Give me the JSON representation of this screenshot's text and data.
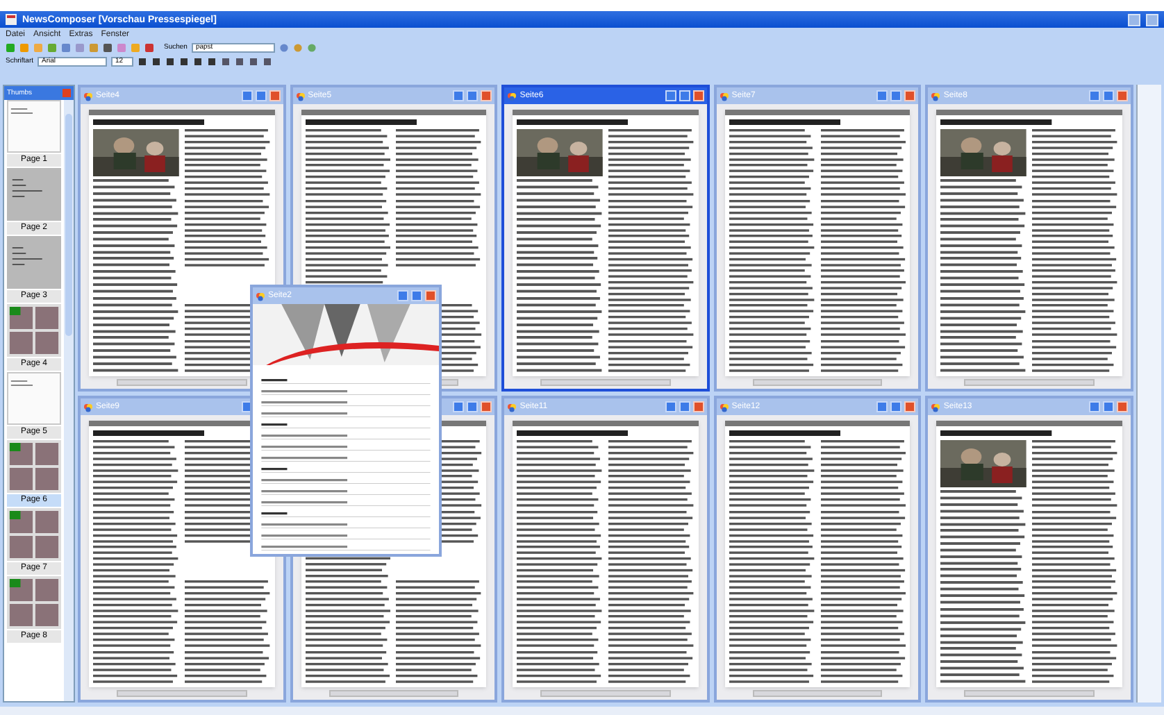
{
  "window": {
    "title": "NewsComposer [Vorschau Pressespiegel]"
  },
  "menu": [
    "Datei",
    "Ansicht",
    "Extras",
    "Fenster"
  ],
  "toolbar": {
    "search_label": "Suchen",
    "search_value": "papst",
    "font_label": "Schriftart",
    "font_value": "Arial",
    "size_value": "12"
  },
  "thumbs": {
    "title": "Thumbs",
    "pages": [
      {
        "label": "Page 1",
        "selected": false,
        "kind": "blank"
      },
      {
        "label": "Page 2",
        "selected": false,
        "kind": "summary"
      },
      {
        "label": "Page 3",
        "selected": false,
        "kind": "summary"
      },
      {
        "label": "Page 4",
        "selected": false,
        "kind": "articles"
      },
      {
        "label": "Page 5",
        "selected": false,
        "kind": "blank"
      },
      {
        "label": "Page 6",
        "selected": true,
        "kind": "articles"
      },
      {
        "label": "Page 7",
        "selected": false,
        "kind": "articles"
      },
      {
        "label": "Page 8",
        "selected": false,
        "kind": "articles"
      }
    ]
  },
  "documents": [
    {
      "title": "Seite4",
      "active": false
    },
    {
      "title": "Seite5",
      "active": false,
      "kind": "text"
    },
    {
      "title": "Seite6",
      "active": true
    },
    {
      "title": "Seite7",
      "active": false,
      "kind": "text"
    },
    {
      "title": "Seite8",
      "active": false
    },
    {
      "title": "Seite9",
      "active": false,
      "kind": "text"
    },
    {
      "active": false,
      "kind": "text"
    },
    {
      "title": "Seite11",
      "active": false,
      "kind": "text"
    },
    {
      "title": "Seite12",
      "active": false,
      "kind": "text"
    },
    {
      "title": "Seite13",
      "active": false
    }
  ],
  "floating": {
    "title": "Seite2",
    "active": false
  }
}
